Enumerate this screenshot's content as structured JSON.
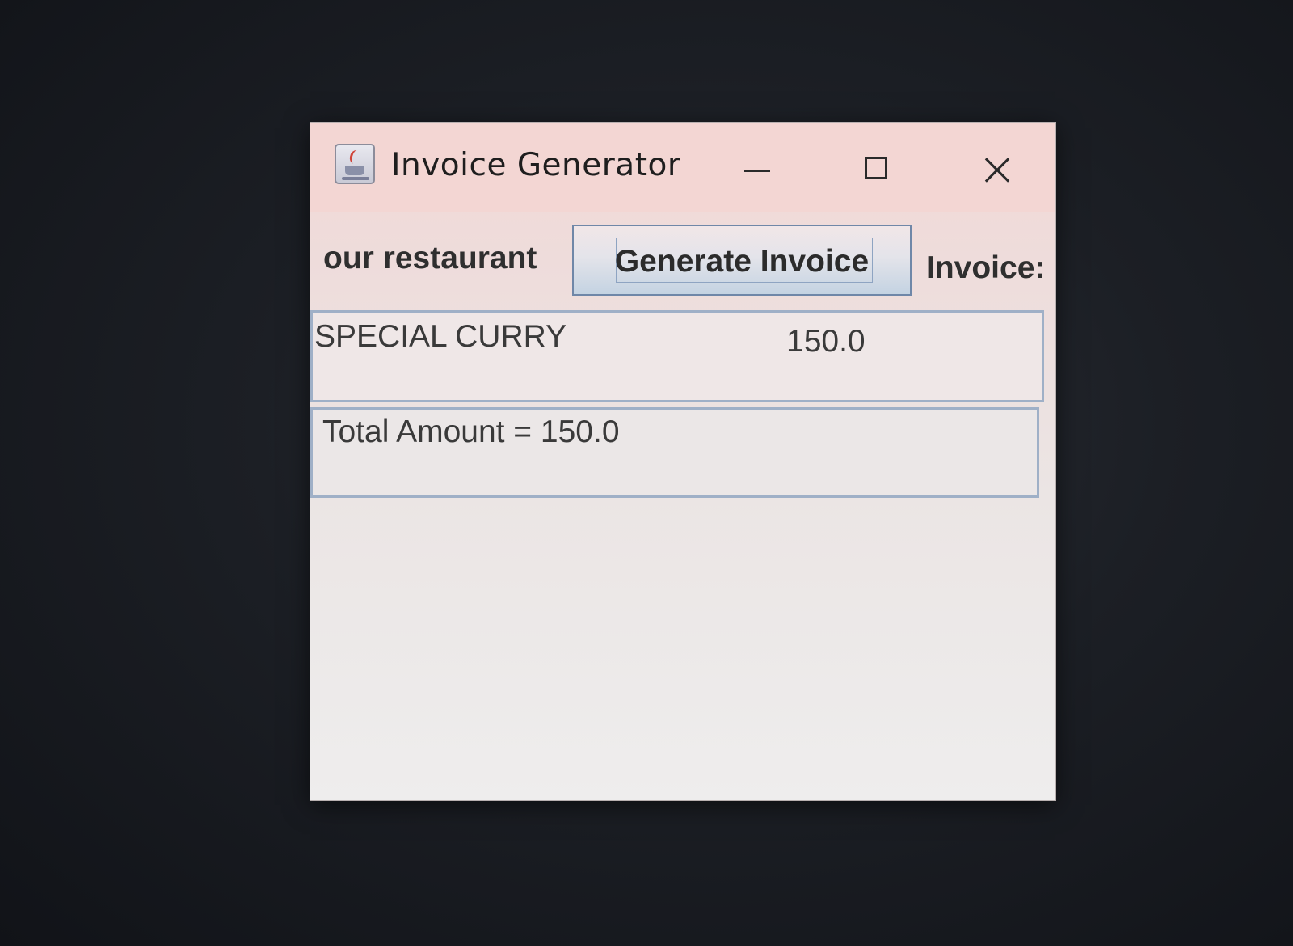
{
  "window": {
    "title": "Invoice Generator",
    "app_icon": "java-cup-icon",
    "controls": {
      "minimize": "minimize-icon",
      "maximize": "maximize-icon",
      "close": "close-icon"
    }
  },
  "toolbar": {
    "restaurant_label": "our restaurant",
    "generate_button_label": "Generate Invoice",
    "invoice_label": "Invoice:"
  },
  "invoice": {
    "items": [
      {
        "name": "SPECIAL CURRY",
        "price": "150.0"
      }
    ],
    "total_text": "Total Amount = 150.0"
  },
  "colors": {
    "title_bar": "#f3d6d3",
    "window_body": "#eeeded",
    "field_border": "#9fb0c7",
    "button_border": "#6f87a8"
  }
}
